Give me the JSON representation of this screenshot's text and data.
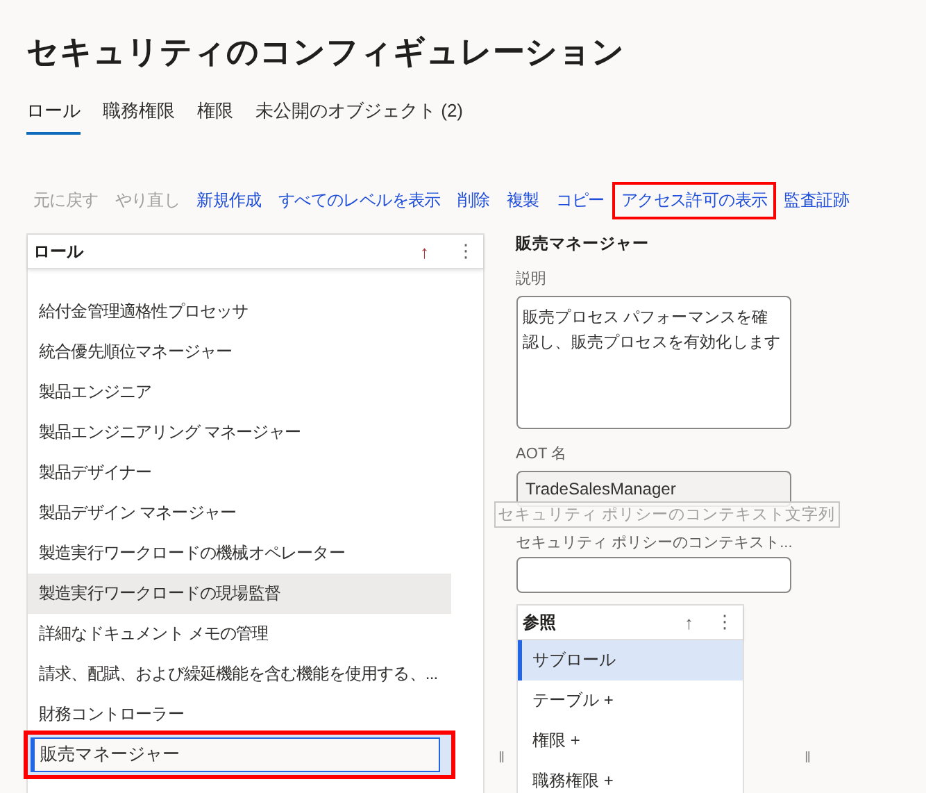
{
  "title": "セキュリティのコンフィギュレーション",
  "tabs": [
    {
      "label": "ロール",
      "selected": true
    },
    {
      "label": "職務権限",
      "selected": false
    },
    {
      "label": "権限",
      "selected": false
    },
    {
      "label": "未公開のオブジェクト (2)",
      "selected": false
    }
  ],
  "toolbar": [
    {
      "label": "元に戻す",
      "disabled": true,
      "highlighted": false
    },
    {
      "label": "やり直し",
      "disabled": true,
      "highlighted": false
    },
    {
      "label": "新規作成",
      "disabled": false,
      "highlighted": false
    },
    {
      "label": "すべてのレベルを表示",
      "disabled": false,
      "highlighted": false
    },
    {
      "label": "削除",
      "disabled": false,
      "highlighted": false
    },
    {
      "label": "複製",
      "disabled": false,
      "highlighted": false
    },
    {
      "label": "コピー",
      "disabled": false,
      "highlighted": false
    },
    {
      "label": "アクセス許可の表示",
      "disabled": false,
      "highlighted": true
    },
    {
      "label": "監査証跡",
      "disabled": false,
      "highlighted": false
    }
  ],
  "roles": {
    "header": "ロール",
    "sort_icon": "↑",
    "menu_icon": "⋮",
    "rows": [
      {
        "label": "給付金管理適格性プロセッサ",
        "hovered": false,
        "selected": false,
        "highlighted": false
      },
      {
        "label": "統合優先順位マネージャー",
        "hovered": false,
        "selected": false,
        "highlighted": false
      },
      {
        "label": "製品エンジニア",
        "hovered": false,
        "selected": false,
        "highlighted": false
      },
      {
        "label": "製品エンジニアリング マネージャー",
        "hovered": false,
        "selected": false,
        "highlighted": false
      },
      {
        "label": "製品デザイナー",
        "hovered": false,
        "selected": false,
        "highlighted": false
      },
      {
        "label": "製品デザイン マネージャー",
        "hovered": false,
        "selected": false,
        "highlighted": false
      },
      {
        "label": "製造実行ワークロードの機械オペレーター",
        "hovered": false,
        "selected": false,
        "highlighted": false
      },
      {
        "label": "製造実行ワークロードの現場監督",
        "hovered": true,
        "selected": false,
        "highlighted": false
      },
      {
        "label": "詳細なドキュメント メモの管理",
        "hovered": false,
        "selected": false,
        "highlighted": false
      },
      {
        "label": "請求、配賦、および繰延機能を含む機能を使用する、...",
        "hovered": false,
        "selected": false,
        "highlighted": false
      },
      {
        "label": "財務コントローラー",
        "hovered": false,
        "selected": false,
        "highlighted": false
      },
      {
        "label": "販売マネージャー",
        "hovered": false,
        "selected": true,
        "highlighted": true
      }
    ]
  },
  "splitters": [
    "‖",
    "‖"
  ],
  "details": {
    "heading": "販売マネージャー",
    "description_label": "説明",
    "description": "販売プロセス パフォーマンスを確認し、販売プロセスを有効化します",
    "aot_label": "AOT 名",
    "aot_value": "TradeSalesManager",
    "policy_label": "セキュリティ ポリシーのコンテキスト...",
    "policy_tooltip": "セキュリティ ポリシーのコンテキスト文字列"
  },
  "references": {
    "header": "参照",
    "sort_icon": "↑",
    "menu_icon": "⋮",
    "rows": [
      {
        "label": "サブロール",
        "selected": true
      },
      {
        "label": "テーブル +",
        "selected": false
      },
      {
        "label": "権限 +",
        "selected": false
      },
      {
        "label": "職務権限 +",
        "selected": false
      }
    ]
  }
}
